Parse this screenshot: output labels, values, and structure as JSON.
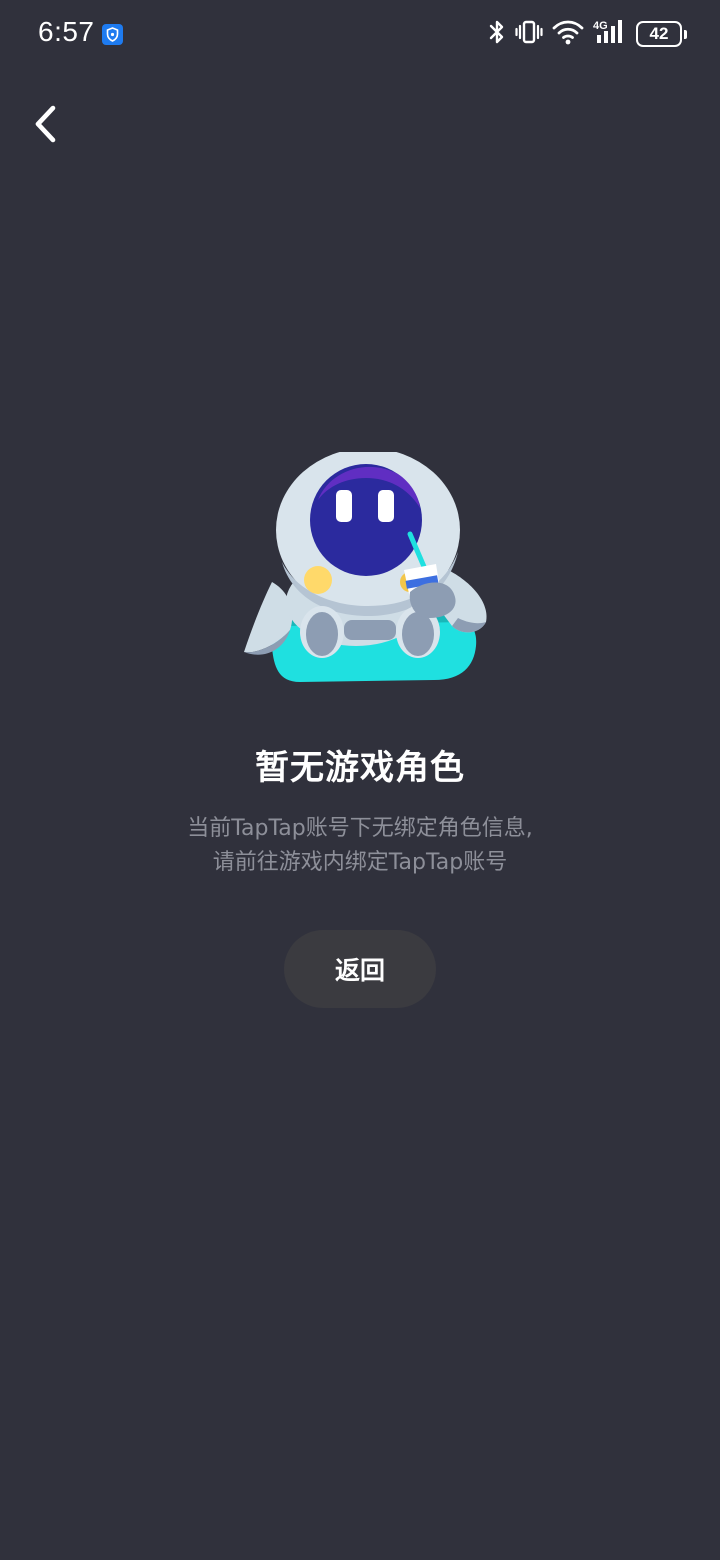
{
  "status_bar": {
    "time": "6:57",
    "battery_level": "42",
    "icons": [
      "shield-icon",
      "bluetooth-icon",
      "vibrate-icon",
      "wifi-icon",
      "signal-4g-icon",
      "battery-icon"
    ]
  },
  "nav": {
    "back_icon": "chevron-left-icon"
  },
  "empty_state": {
    "illustration": "robot-mascot-illustration",
    "title": "暂无游戏角色",
    "description_line1": "当前TapTap账号下无绑定角色信息,",
    "description_line2": "请前往游戏内绑定TapTap账号",
    "button_label": "返回"
  },
  "colors": {
    "background": "#30313c",
    "button_bg": "#3b3b40",
    "muted_text": "#8d8f99",
    "accent_teal": "#1fe0e0",
    "mascot_face": "#2b2a9e"
  }
}
